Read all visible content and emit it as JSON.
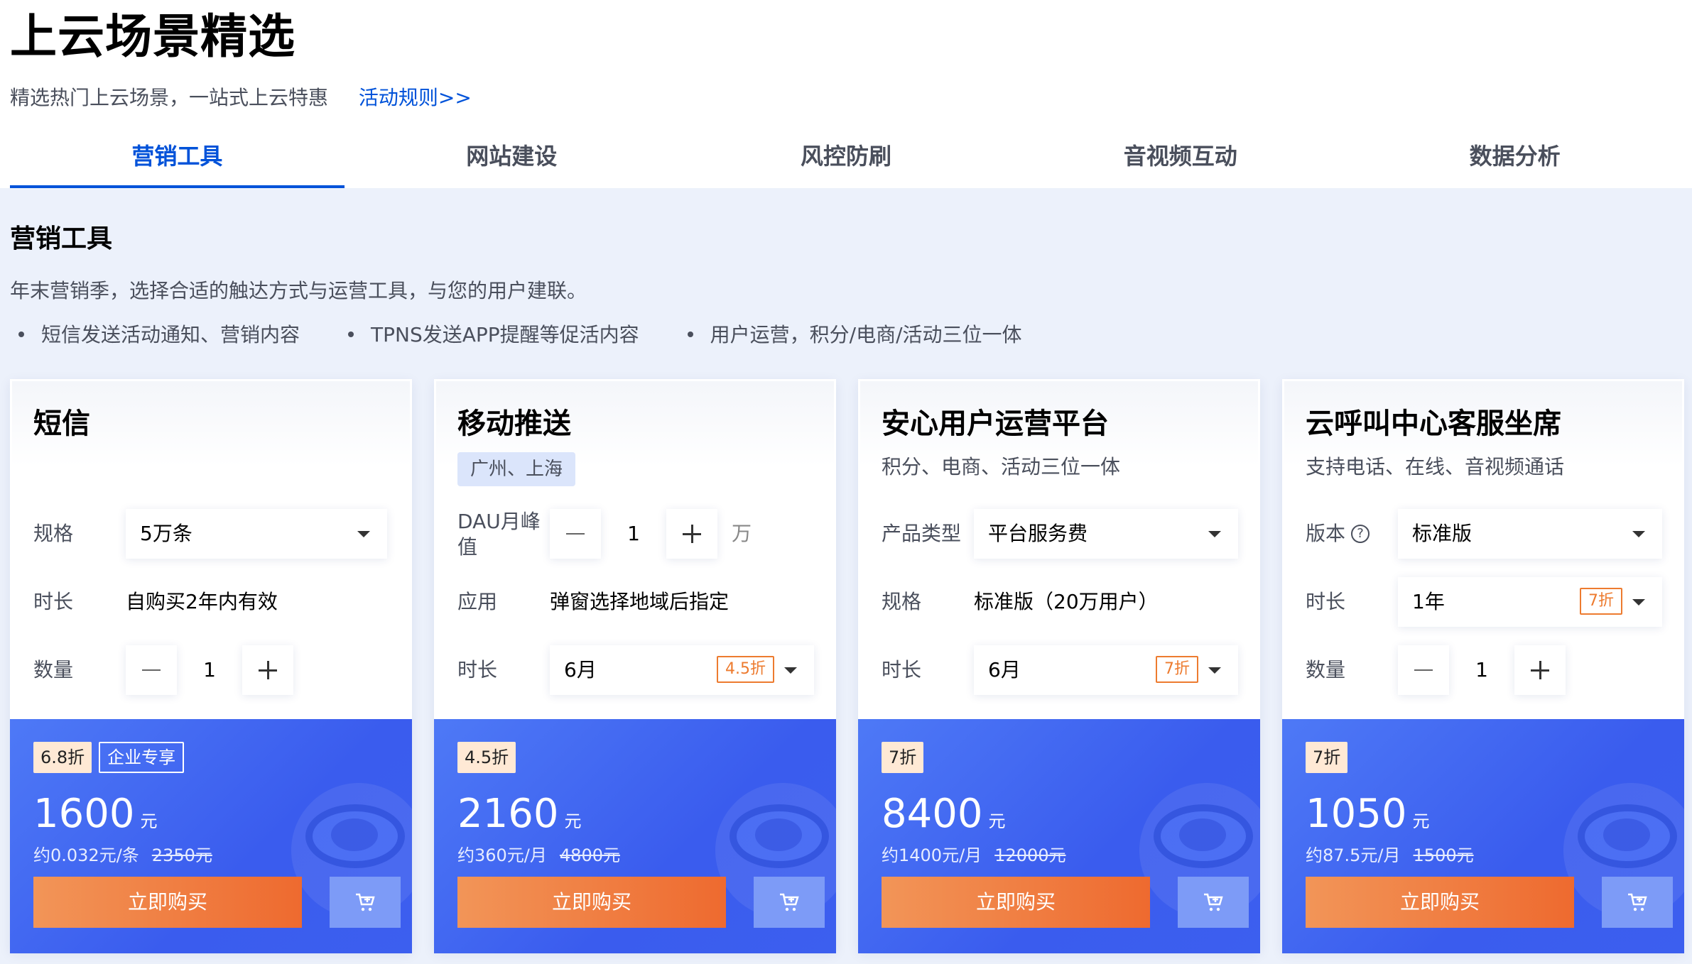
{
  "header": {
    "title": "上云场景精选",
    "subtitle": "精选热门上云场景，一站式上云特惠",
    "rules_link": "活动规则>>"
  },
  "tabs": [
    {
      "label": "营销工具",
      "active": true
    },
    {
      "label": "网站建设",
      "active": false
    },
    {
      "label": "风控防刷",
      "active": false
    },
    {
      "label": "音视频互动",
      "active": false
    },
    {
      "label": "数据分析",
      "active": false
    }
  ],
  "section": {
    "title": "营销工具",
    "description": "年末营销季，选择合适的触达方式与运营工具，与您的用户建联。",
    "bullets": [
      "短信发送活动通知、营销内容",
      "TPNS发送APP提醒等促活内容",
      "用户运营，积分/电商/活动三位一体"
    ]
  },
  "cards": [
    {
      "name": "短信",
      "spec_label": "规格",
      "spec_value": "5万条",
      "duration_label": "时长",
      "duration_value": "自购买2年内有效",
      "qty_label": "数量",
      "qty_value": "1",
      "discount": "6.8折",
      "enterprise": "企业专享",
      "price": "1600",
      "price_unit": "元",
      "unit_price": "约0.032元/条",
      "orig_price": "2350元",
      "buy_label": "立即购买"
    },
    {
      "name": "移动推送",
      "tag": "广州、上海",
      "dau_label": "DAU月峰值",
      "dau_value": "1",
      "dau_unit": "万",
      "app_label": "应用",
      "app_value": "弹窗选择地域后指定",
      "duration_label": "时长",
      "duration_value": "6月",
      "duration_discount": "4.5折",
      "discount": "4.5折",
      "price": "2160",
      "price_unit": "元",
      "unit_price": "约360元/月",
      "orig_price": "4800元",
      "buy_label": "立即购买"
    },
    {
      "name": "安心用户运营平台",
      "subtitle": "积分、电商、活动三位一体",
      "type_label": "产品类型",
      "type_value": "平台服务费",
      "spec_label": "规格",
      "spec_value": "标准版（20万用户）",
      "duration_label": "时长",
      "duration_value": "6月",
      "duration_discount": "7折",
      "discount": "7折",
      "price": "8400",
      "price_unit": "元",
      "unit_price": "约1400元/月",
      "orig_price": "12000元",
      "buy_label": "立即购买"
    },
    {
      "name": "云呼叫中心客服坐席",
      "subtitle": "支持电话、在线、音视频通话",
      "version_label": "版本",
      "version_value": "标准版",
      "duration_label": "时长",
      "duration_value": "1年",
      "duration_discount": "7折",
      "qty_label": "数量",
      "qty_value": "1",
      "discount": "7折",
      "price": "1050",
      "price_unit": "元",
      "unit_price": "约87.5元/月",
      "orig_price": "1500元",
      "buy_label": "立即购买"
    }
  ],
  "icons": {
    "help": "question-circle-icon",
    "cart": "cart-icon",
    "caret": "chevron-down-icon"
  },
  "colors": {
    "brand": "#0052d9",
    "price_panel": "#3a5cee",
    "buy_button": "#ee6a2f",
    "discount_outline": "#ed7b2f"
  }
}
